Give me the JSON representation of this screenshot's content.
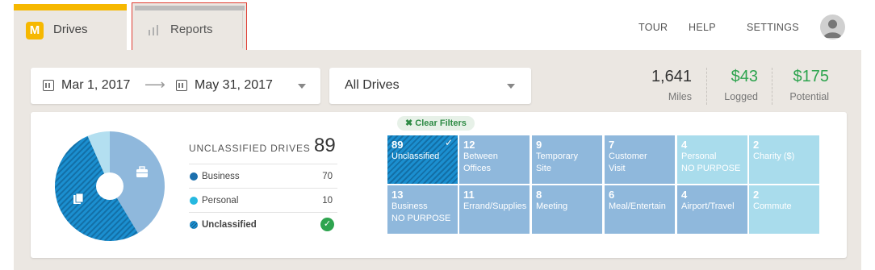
{
  "nav": {
    "drives_tab": "Drives",
    "drives_logo": "M",
    "reports_tab": "Reports",
    "links": [
      "TOUR",
      "HELP",
      "SETTINGS"
    ]
  },
  "filters": {
    "start_date": "Mar 1, 2017",
    "end_date": "May 31, 2017",
    "arrow": "⟶",
    "drives_select": "All Drives"
  },
  "stats": [
    {
      "value": "1,641",
      "label": "Miles",
      "color": "#333333"
    },
    {
      "value": "$43",
      "label": "Logged",
      "color": "#2ea44f"
    },
    {
      "value": "$175",
      "label": "Potential",
      "color": "#2ea44f"
    }
  ],
  "summary": {
    "title": "UNCLASSIFIED DRIVES",
    "count": "89",
    "legend": [
      {
        "name": "Business",
        "value": "70",
        "color": "#1b6fad"
      },
      {
        "name": "Personal",
        "value": "10",
        "color": "#26b8e0"
      },
      {
        "name": "Unclassified",
        "value": "",
        "color": "#136fa6"
      }
    ],
    "check_icon": "✓"
  },
  "pie": {
    "slices": [
      {
        "name": "Business",
        "fraction": 0.414,
        "color": "#8fb8dc"
      },
      {
        "name": "Unclassified",
        "fraction": 0.52,
        "color": "#1b8fd0"
      },
      {
        "name": "Personal",
        "fraction": 0.066,
        "color": "#b3dff0"
      }
    ]
  },
  "clear_filters": "✖ Clear Filters",
  "tiles": [
    {
      "num": "89",
      "text": "Unclassified",
      "style": "selected",
      "check": "✓"
    },
    {
      "num": "12",
      "text": "Between\nOffices",
      "style": "dark"
    },
    {
      "num": "9",
      "text": "Temporary\nSite",
      "style": "dark"
    },
    {
      "num": "7",
      "text": "Customer\nVisit",
      "style": "dark"
    },
    {
      "num": "4",
      "text": "Personal\nNO PURPOSE",
      "style": "light"
    },
    {
      "num": "2",
      "text": "Charity ($)",
      "style": "light"
    },
    {
      "num": "13",
      "text": "Business\nNO PURPOSE",
      "style": "dark"
    },
    {
      "num": "11",
      "text": "Errand/Supplies",
      "style": "dark"
    },
    {
      "num": "8",
      "text": "Meeting",
      "style": "dark"
    },
    {
      "num": "6",
      "text": "Meal/Entertain",
      "style": "dark"
    },
    {
      "num": "4",
      "text": "Airport/Travel",
      "style": "dark"
    },
    {
      "num": "2",
      "text": "Commute",
      "style": "light"
    }
  ]
}
